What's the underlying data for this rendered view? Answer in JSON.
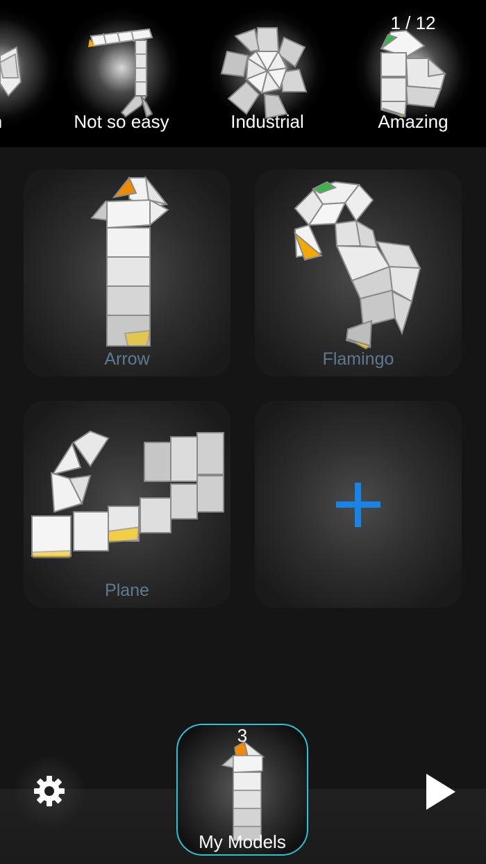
{
  "carousel": {
    "counter": "1 / 12",
    "categories": [
      {
        "label": "n"
      },
      {
        "label": "Not so easy"
      },
      {
        "label": "Industrial"
      },
      {
        "label": "Amazing"
      }
    ]
  },
  "models": [
    {
      "label": "Arrow"
    },
    {
      "label": "Flamingo"
    },
    {
      "label": "Plane"
    }
  ],
  "add_tile": {
    "icon": "plus-icon"
  },
  "bottom": {
    "settings_icon": "gear-icon",
    "play_icon": "play-icon",
    "my_models": {
      "count": "3",
      "label": "My Models"
    }
  },
  "colors": {
    "background": "#151515",
    "carousel_background": "#000000",
    "tile_label": "#5e7a92",
    "plus": "#1a84e6",
    "selected_border": "#27c4d6",
    "accent_orange": "#f08a00",
    "accent_green": "#39b54a",
    "accent_yellow": "#f5c400"
  }
}
